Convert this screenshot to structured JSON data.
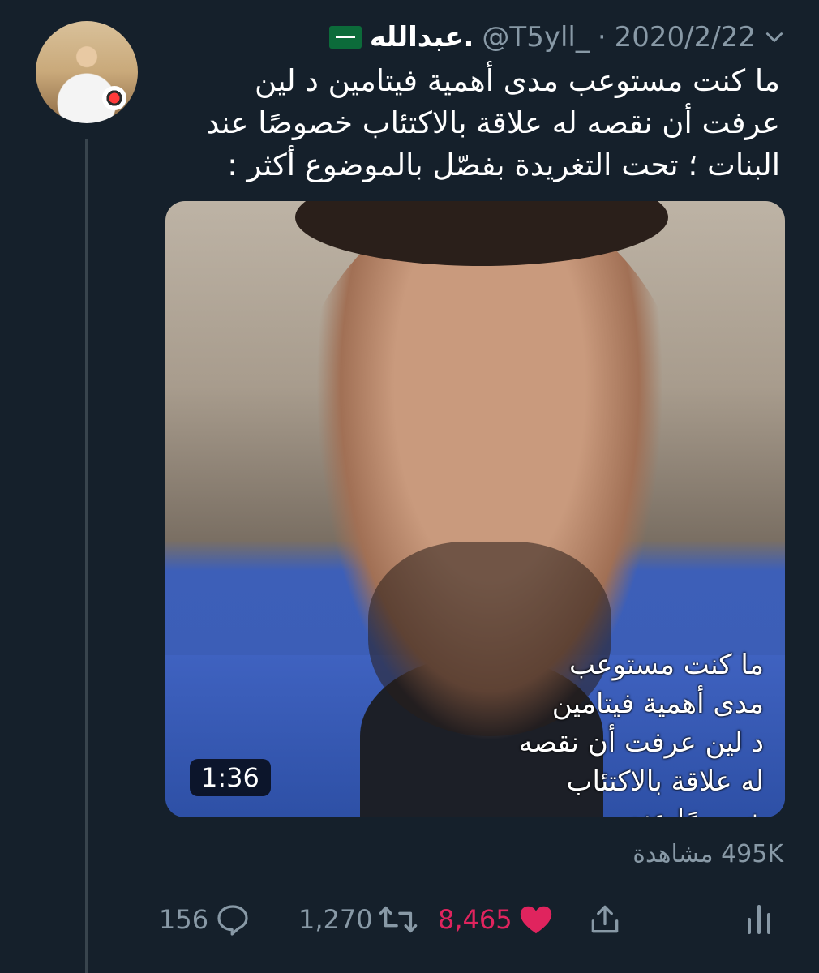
{
  "tweet": {
    "author_name": "عبدالله.",
    "handle": "@T5yll_",
    "separator": "·",
    "date": "2020/2/22",
    "text": "ما كنت مستوعب مدى أهمية فيتامين د لين\nعرفت أن نقصه له علاقة بالاكتئاب خصوصًا عند\nالبنات ؛ تحت التغريدة بفصّل بالموضوع أكثر :",
    "flag_icon": "saudi-flag-icon"
  },
  "media": {
    "overlay_text": "ما كنت مستوعب\nمدى أهمية فيتامين\nد لين عرفت أن نقصه\nله علاقة بالاكتئاب\nخصوصًا عند",
    "duration": "1:36",
    "views": "495K مشاهدة"
  },
  "actions": {
    "reply_count": "156",
    "retweet_count": "1,270",
    "like_count": "8,465",
    "colors": {
      "muted": "#8899a6",
      "liked": "#e0245e",
      "background": "#15202b"
    }
  }
}
